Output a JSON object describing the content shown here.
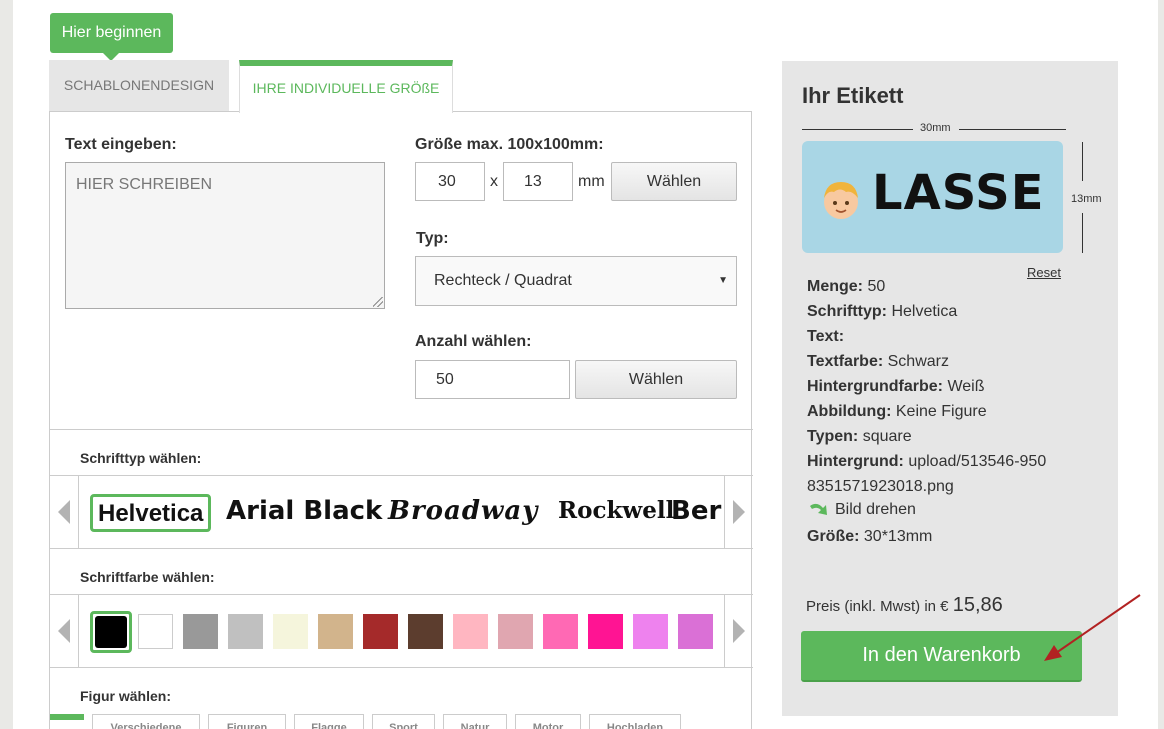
{
  "start_button": "Hier beginnen",
  "tabs": [
    {
      "label": "SCHABLONENDESIGN"
    },
    {
      "label": "IHRE INDIVIDUELLE GRÖßE"
    }
  ],
  "form": {
    "text_label": "Text eingeben:",
    "text_placeholder": "HIER SCHREIBEN",
    "size_label": "Größe max. 100x100mm:",
    "width_value": "30",
    "x_sep": "x",
    "height_value": "13",
    "unit": "mm",
    "size_button": "Wählen",
    "type_label": "Typ:",
    "type_value": "Rechteck / Quadrat",
    "qty_label": "Anzahl wählen:",
    "qty_value": "50",
    "qty_button": "Wählen"
  },
  "fonts_section": {
    "label": "Schrifttyp wählen:",
    "items": [
      "Helvetica",
      "Arial Black",
      "Broadway",
      "Rockwell",
      "Berl"
    ]
  },
  "colors_section": {
    "label": "Schriftfarbe wählen:",
    "swatches": [
      "#000000",
      "#ffffff",
      "#999999",
      "#c0c0c0",
      "#f5f5dc",
      "#d2b48c",
      "#a52a2a",
      "#5c3d2e",
      "#ffb6c1",
      "#e0a6b0",
      "#ff69b4",
      "#ff1493",
      "#ee82ee",
      "#da70d6",
      "#ff00ff"
    ]
  },
  "figure_section": {
    "label": "Figur wählen:",
    "tabs": [
      "Verschiedene",
      "Figuren",
      "Flagge",
      "Sport",
      "Natur",
      "Motor",
      "Hochladen"
    ]
  },
  "label_panel": {
    "title": "Ihr Etikett",
    "width_dim": "30mm",
    "height_dim": "13mm",
    "preview_text": "LASSE",
    "reset": "Reset",
    "menge_key": "Menge:",
    "menge_val": " 50",
    "schrift_key": "Schrifttyp:",
    "schrift_val": " Helvetica",
    "text_key": "Text:",
    "text_val": "",
    "textfarbe_key": "Textfarbe:",
    "textfarbe_val": " Schwarz",
    "hgfarbe_key": "Hintergrundfarbe:",
    "hgfarbe_val": " Weiß",
    "abbildung_key": "Abbildung:",
    "abbildung_val": " Keine Figure",
    "typen_key": "Typen:",
    "typen_val": " square",
    "hintergrund_key": "Hintergrund:",
    "hintergrund_val": " upload/513546-9508351571923018.png",
    "rotate_label": "Bild drehen",
    "groesse_key": "Größe:",
    "groesse_val": " 30*13mm",
    "price_label": "Preis (inkl. Mwst) in €",
    "price_value": "15,86",
    "cart_button": "In den Warenkorb"
  },
  "colors": {
    "accent": "#5cb85c",
    "preview_bg": "#a9d6e5",
    "arrow": "#b22222"
  }
}
